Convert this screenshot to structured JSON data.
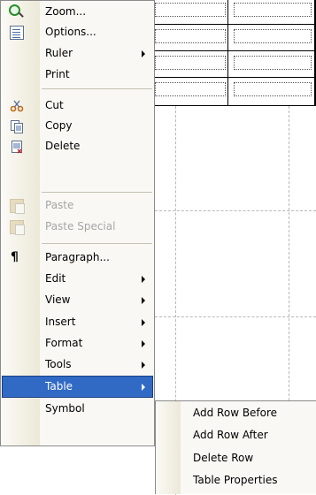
{
  "menu": {
    "items": [
      {
        "label": "Zoom...",
        "icon": "zoom-icon"
      },
      {
        "label": "Options...",
        "icon": "options-icon"
      },
      {
        "label": "Ruler",
        "submenu": true
      },
      {
        "label": "Print"
      },
      {
        "label": "Cut",
        "icon": "cut-icon"
      },
      {
        "label": "Copy",
        "icon": "copy-icon"
      },
      {
        "label": "Delete",
        "icon": "delete-icon"
      },
      {
        "label": "Paste",
        "icon": "paste-icon",
        "disabled": true
      },
      {
        "label": "Paste Special",
        "icon": "paste-special-icon",
        "disabled": true
      },
      {
        "label": "Paragraph...",
        "icon": "paragraph-icon"
      },
      {
        "label": "Edit",
        "submenu": true
      },
      {
        "label": "View",
        "submenu": true
      },
      {
        "label": "Insert",
        "submenu": true
      },
      {
        "label": "Format",
        "submenu": true
      },
      {
        "label": "Tools",
        "submenu": true
      },
      {
        "label": "Table",
        "submenu": true,
        "highlighted": true
      },
      {
        "label": "Symbol"
      }
    ],
    "paragraph_glyph": "¶",
    "highlight_color": "#316ac5"
  },
  "submenu": {
    "items": [
      {
        "label": "Add Row Before"
      },
      {
        "label": "Add Row After"
      },
      {
        "label": "Delete Row"
      },
      {
        "label": "Table Properties"
      }
    ]
  }
}
